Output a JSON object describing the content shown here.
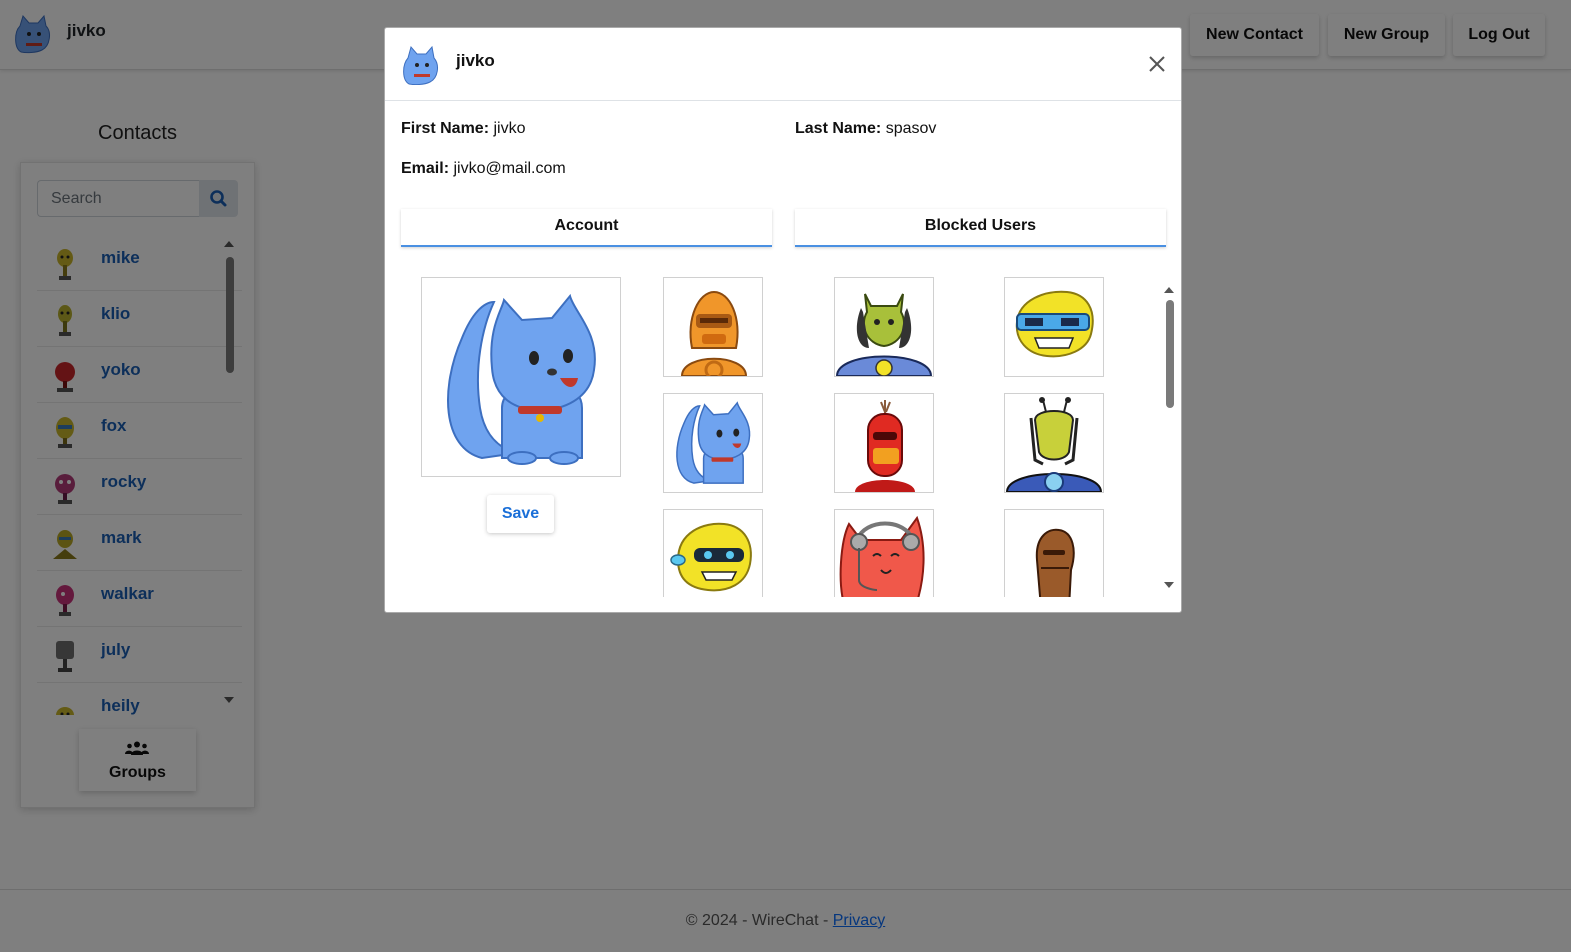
{
  "navbar": {
    "username": "jivko",
    "new_contact_label": "New Contact",
    "new_group_label": "New Group",
    "logout_label": "Log Out"
  },
  "contacts": {
    "title": "Contacts",
    "search_placeholder": "Search",
    "items": [
      {
        "name": "mike",
        "color": "#c8b52a"
      },
      {
        "name": "klio",
        "color": "#b9b12e"
      },
      {
        "name": "yoko",
        "color": "#c8262a"
      },
      {
        "name": "fox",
        "color": "#c9b62a"
      },
      {
        "name": "rocky",
        "color": "#b23a78"
      },
      {
        "name": "mark",
        "color": "#b9a826"
      },
      {
        "name": "walkar",
        "color": "#c8327a"
      },
      {
        "name": "july",
        "color": "#6e6e6e"
      },
      {
        "name": "heily",
        "color": "#c9b62a"
      }
    ],
    "groups_label": "Groups"
  },
  "footer": {
    "copyright": "© 2024 - WireChat - ",
    "privacy_label": "Privacy"
  },
  "modal": {
    "title": "jivko",
    "first_name_label": "First Name:",
    "first_name": "jivko",
    "last_name_label": "Last Name:",
    "last_name": "spasov",
    "email_label": "Email:",
    "email": "jivko@mail.com",
    "tabs": [
      "Account",
      "Blocked Users"
    ],
    "save_label": "Save",
    "avatar_options": [
      "orange-robot",
      "blue-cat",
      "yellow-robot-mask",
      "green-alien",
      "red-robot",
      "red-cat-headphones",
      "yellow-robot-visor",
      "alien-armor",
      "brown-robot"
    ]
  },
  "colors": {
    "accent": "#1a5fb4",
    "tab_underline": "#4a90e2",
    "cat_blue": "#6fa3ef"
  }
}
